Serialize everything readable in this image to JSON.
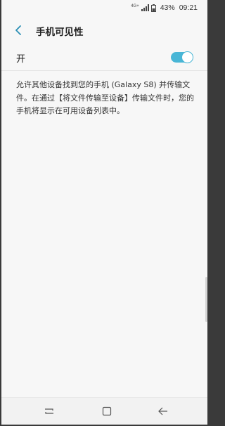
{
  "status_bar": {
    "network_type": "4G+",
    "battery_percent": "43%",
    "time": "09:21"
  },
  "header": {
    "title": "手机可见性"
  },
  "visibility_toggle": {
    "label": "开",
    "state": "on",
    "accent_color": "#49b6d6"
  },
  "description": {
    "text": "允许其他设备找到您的手机 (Galaxy S8) 并传输文件。在通过【将文件传输至设备】传输文件时，您的手机将显示在可用设备列表中。"
  },
  "nav_bar": {
    "buttons": [
      "recent-apps-icon",
      "home-icon",
      "back-icon"
    ]
  }
}
